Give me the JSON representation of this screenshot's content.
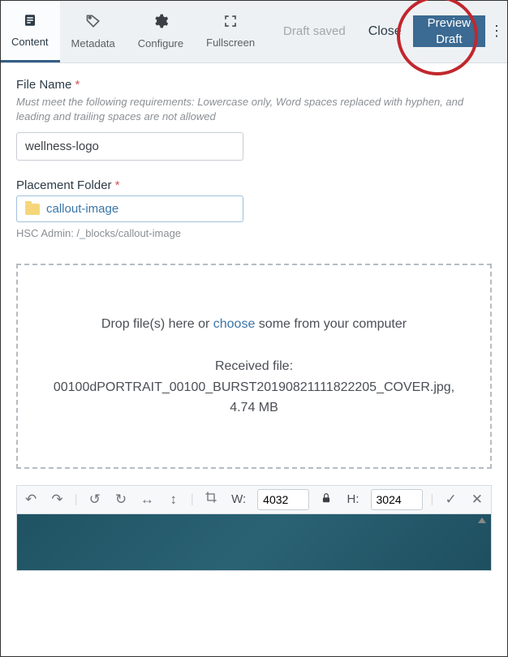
{
  "toolbar": {
    "tabs": [
      {
        "label": "Content"
      },
      {
        "label": "Metadata"
      },
      {
        "label": "Configure"
      },
      {
        "label": "Fullscreen"
      }
    ],
    "draft_saved": "Draft saved",
    "close_label": "Close",
    "preview_line1": "Preview",
    "preview_line2": "Draft",
    "more_label": "⋮"
  },
  "file_name": {
    "label": "File Name",
    "hint": "Must meet the following requirements: Lowercase only, Word spaces replaced with hyphen, and leading and trailing spaces are not allowed",
    "value": "wellness-logo"
  },
  "placement_folder": {
    "label": "Placement Folder",
    "value": "callout-image",
    "path": "HSC Admin: /_blocks/callout-image"
  },
  "dropzone": {
    "text_before": "Drop file(s) here or ",
    "choose": "choose",
    "text_after": " some from your computer",
    "received_label": "Received file:",
    "received_file": "00100dPORTRAIT_00100_BURST20190821111822205_COVER.jpg, 4.74 MB"
  },
  "image_editor": {
    "w_label": "W:",
    "w_value": "4032",
    "h_label": "H:",
    "h_value": "3024"
  }
}
